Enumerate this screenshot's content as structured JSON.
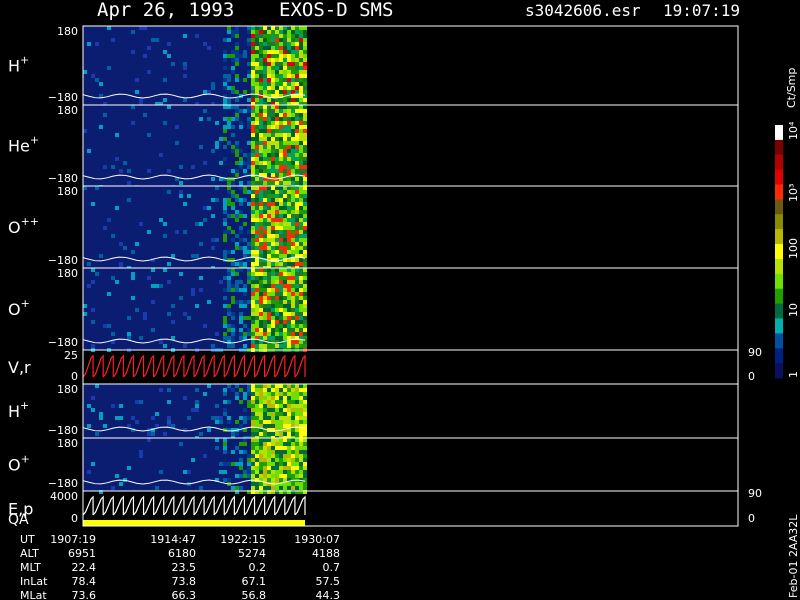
{
  "header": {
    "date": "Apr 26, 1993",
    "mission": "EXOS-D SMS",
    "file": "s3042606.esr",
    "time": "19:07:19"
  },
  "colorbar": {
    "unit": "Ct/Smp",
    "labels": [
      "10⁴",
      "10³",
      "100",
      "10",
      "1"
    ],
    "colors": [
      "#ffffff",
      "#7a0000",
      "#b00000",
      "#e00000",
      "#ff2a00",
      "#6b5a10",
      "#8a8a00",
      "#b8b800",
      "#ffff00",
      "#b8e000",
      "#6ee000",
      "#1ea000",
      "#006a40",
      "#00b0b0",
      "#0050a0",
      "#002080",
      "#0a1060"
    ]
  },
  "panels": [
    {
      "label": "H",
      "sup": "+",
      "ytop": "180",
      "ybot": "−180"
    },
    {
      "label": "He",
      "sup": "+",
      "ytop": "180",
      "ybot": "−180"
    },
    {
      "label": "O",
      "sup": "++",
      "ytop": "180",
      "ybot": "−180"
    },
    {
      "label": "O",
      "sup": "+",
      "ytop": "180",
      "ybot": "−180"
    },
    {
      "label": "V,r",
      "sup": "",
      "ytop": "25",
      "ybot": "0",
      "rtop": "90",
      "rbot": "0"
    },
    {
      "label": "H",
      "sup": "+",
      "ytop": "180",
      "ybot": "−180"
    },
    {
      "label": "O",
      "sup": "+",
      "ytop": "180",
      "ybot": "−180"
    },
    {
      "label": "E,p",
      "label2": "QA",
      "sup": "",
      "ytop": "4000",
      "ybot": "0",
      "rtop": "90",
      "rbot": "0"
    }
  ],
  "footer": {
    "rows": [
      {
        "name": "UT",
        "values": [
          "1907:19",
          "1914:47",
          "1922:15",
          "1930:07"
        ]
      },
      {
        "name": "ALT",
        "values": [
          "6951",
          "6180",
          "5274",
          "4188"
        ]
      },
      {
        "name": "MLT",
        "values": [
          "22.4",
          "23.5",
          "0.2",
          "0.7"
        ]
      },
      {
        "name": "InLat",
        "values": [
          "78.4",
          "73.8",
          "67.1",
          "57.5"
        ]
      },
      {
        "name": "MLat",
        "values": [
          "73.6",
          "66.3",
          "56.8",
          "44.3"
        ]
      }
    ],
    "side_note": "Feb-01 2AA32L"
  },
  "chart_data": {
    "type": "heatmap",
    "title": "Apr 26, 1993   EXOS-D SMS",
    "time_ticks": [
      "1907:19",
      "1914:47",
      "1922:15",
      "1930:07"
    ],
    "panels": [
      "H+",
      "He+",
      "O++",
      "O+",
      "V,r",
      "H+",
      "O+",
      "E,p QA"
    ],
    "y_range": [
      -180,
      180
    ],
    "color_scale": "log",
    "color_range": [
      1,
      10000
    ]
  }
}
